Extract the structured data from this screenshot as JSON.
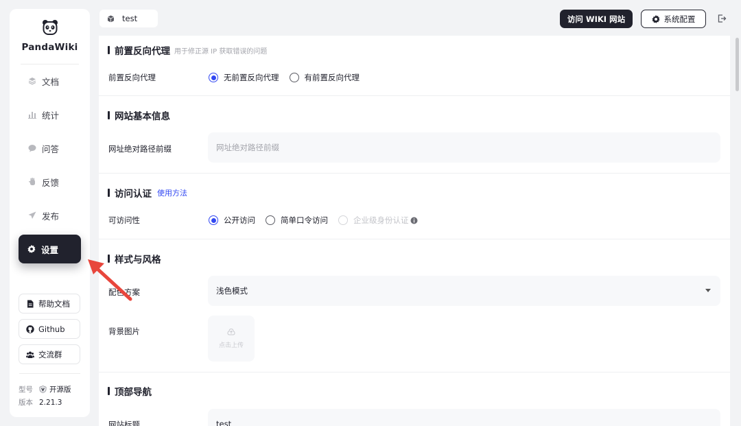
{
  "app": {
    "name": "PandaWiki"
  },
  "sidebar": {
    "items": [
      {
        "label": "文档",
        "icon": "layers-icon"
      },
      {
        "label": "统计",
        "icon": "bar-chart-icon"
      },
      {
        "label": "问答",
        "icon": "chat-icon"
      },
      {
        "label": "反馈",
        "icon": "hand-icon"
      },
      {
        "label": "发布",
        "icon": "send-icon"
      },
      {
        "label": "设置",
        "icon": "gear-icon",
        "active": true
      }
    ],
    "links": [
      {
        "label": "帮助文档",
        "icon": "doc-icon"
      },
      {
        "label": "Github",
        "icon": "github-icon"
      },
      {
        "label": "交流群",
        "icon": "group-icon"
      }
    ],
    "version": {
      "type_key": "型号",
      "type_value": "开源版",
      "version_key": "版本",
      "version_value": "2.21.3"
    }
  },
  "header": {
    "kb_name": "test",
    "visit_wiki_label": "访问 WIKI 网站",
    "system_config_label": "系统配置"
  },
  "sections": {
    "proxy": {
      "title": "前置反向代理",
      "hint": "用于修正源 IP 获取错误的问题",
      "field_label": "前置反向代理",
      "options": [
        "无前置反向代理",
        "有前置反向代理"
      ],
      "selected": 0
    },
    "basic": {
      "title": "网站基本信息",
      "field_label": "网址绝对路径前缀",
      "placeholder": "网址绝对路径前缀"
    },
    "auth": {
      "title": "访问认证",
      "link": "使用方法",
      "field_label": "可访问性",
      "options": [
        "公开访问",
        "简单口令访问",
        "企业级身份认证"
      ],
      "selected": 0,
      "disabled_index": 2
    },
    "style": {
      "title": "样式与风格",
      "scheme_label": "配色方案",
      "scheme_value": "浅色模式",
      "bg_label": "背景图片",
      "upload_label": "点击上传"
    },
    "nav": {
      "title": "顶部导航",
      "site_title_label": "网站标题",
      "site_title_value": "test"
    }
  },
  "colors": {
    "accent": "#3248f2",
    "dark": "#21222d",
    "arrow": "#e8463c"
  }
}
